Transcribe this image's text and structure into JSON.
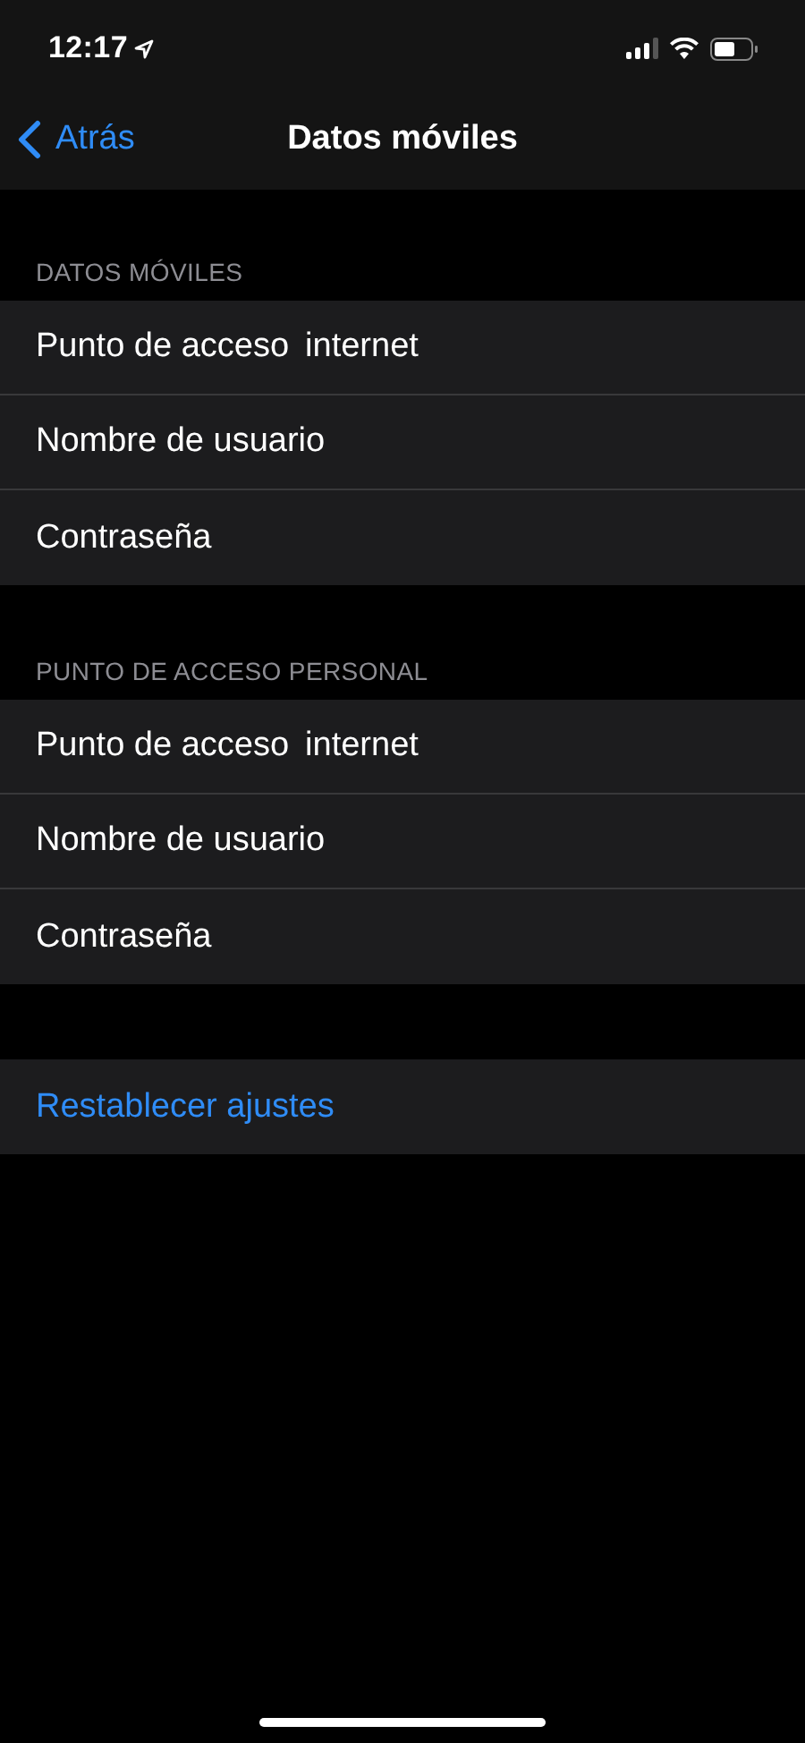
{
  "status_bar": {
    "time": "12:17"
  },
  "nav": {
    "back": "Atrás",
    "title": "Datos móviles"
  },
  "sections": [
    {
      "header": "DATOS MÓVILES",
      "rows": [
        {
          "label": "Punto de acceso",
          "value": "internet"
        },
        {
          "label": "Nombre de usuario"
        },
        {
          "label": "Contraseña"
        }
      ]
    },
    {
      "header": "PUNTO DE ACCESO PERSONAL",
      "rows": [
        {
          "label": "Punto de acceso",
          "value": "internet"
        },
        {
          "label": "Nombre de usuario"
        },
        {
          "label": "Contraseña"
        }
      ]
    }
  ],
  "reset_button": "Restablecer ajustes"
}
